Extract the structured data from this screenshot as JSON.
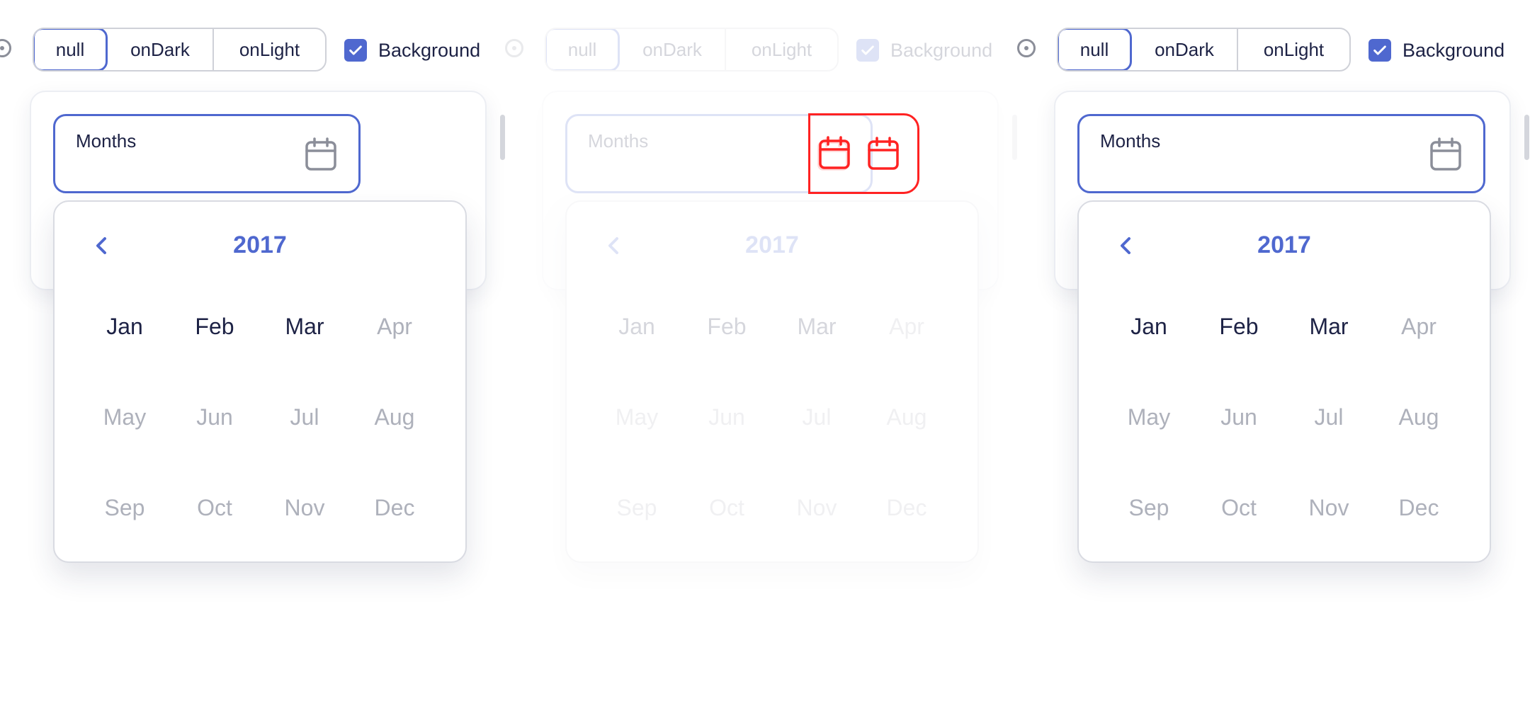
{
  "colors": {
    "accent": "#4f68cf",
    "text": "#1d2245",
    "muted": "#aeb1bb",
    "error": "#ff2222"
  },
  "panels": [
    {
      "theme_options": [
        "null",
        "onDark",
        "onLight"
      ],
      "selected_theme": "null",
      "background_checkbox": {
        "label": "Background",
        "checked": true
      },
      "field": {
        "label": "Months",
        "icon": "calendar-icon"
      },
      "picker": {
        "year": "2017",
        "months": [
          "Jan",
          "Feb",
          "Mar",
          "Apr",
          "May",
          "Jun",
          "Jul",
          "Aug",
          "Sep",
          "Oct",
          "Nov",
          "Dec"
        ],
        "enabled_months": [
          "Jan",
          "Feb",
          "Mar"
        ]
      }
    },
    {
      "theme_options": [
        "null",
        "onDark",
        "onLight"
      ],
      "selected_theme": "null",
      "background_checkbox": {
        "label": "Background",
        "checked": true
      },
      "field": {
        "label": "Months",
        "icon": "calendar-icon"
      },
      "picker": {
        "year": "2017",
        "months": [
          "Jan",
          "Feb",
          "Mar",
          "Apr",
          "May",
          "Jun",
          "Jul",
          "Aug",
          "Sep",
          "Oct",
          "Nov",
          "Dec"
        ],
        "enabled_months": [
          "Jan",
          "Feb",
          "Mar"
        ]
      }
    },
    {
      "theme_options": [
        "null",
        "onDark",
        "onLight"
      ],
      "selected_theme": "null",
      "background_checkbox": {
        "label": "Background",
        "checked": true
      },
      "field": {
        "label": "Months",
        "icon": "calendar-icon"
      },
      "picker": {
        "year": "2017",
        "months": [
          "Jan",
          "Feb",
          "Mar",
          "Apr",
          "May",
          "Jun",
          "Jul",
          "Aug",
          "Sep",
          "Oct",
          "Nov",
          "Dec"
        ],
        "enabled_months": [
          "Jan",
          "Feb",
          "Mar"
        ]
      }
    }
  ]
}
